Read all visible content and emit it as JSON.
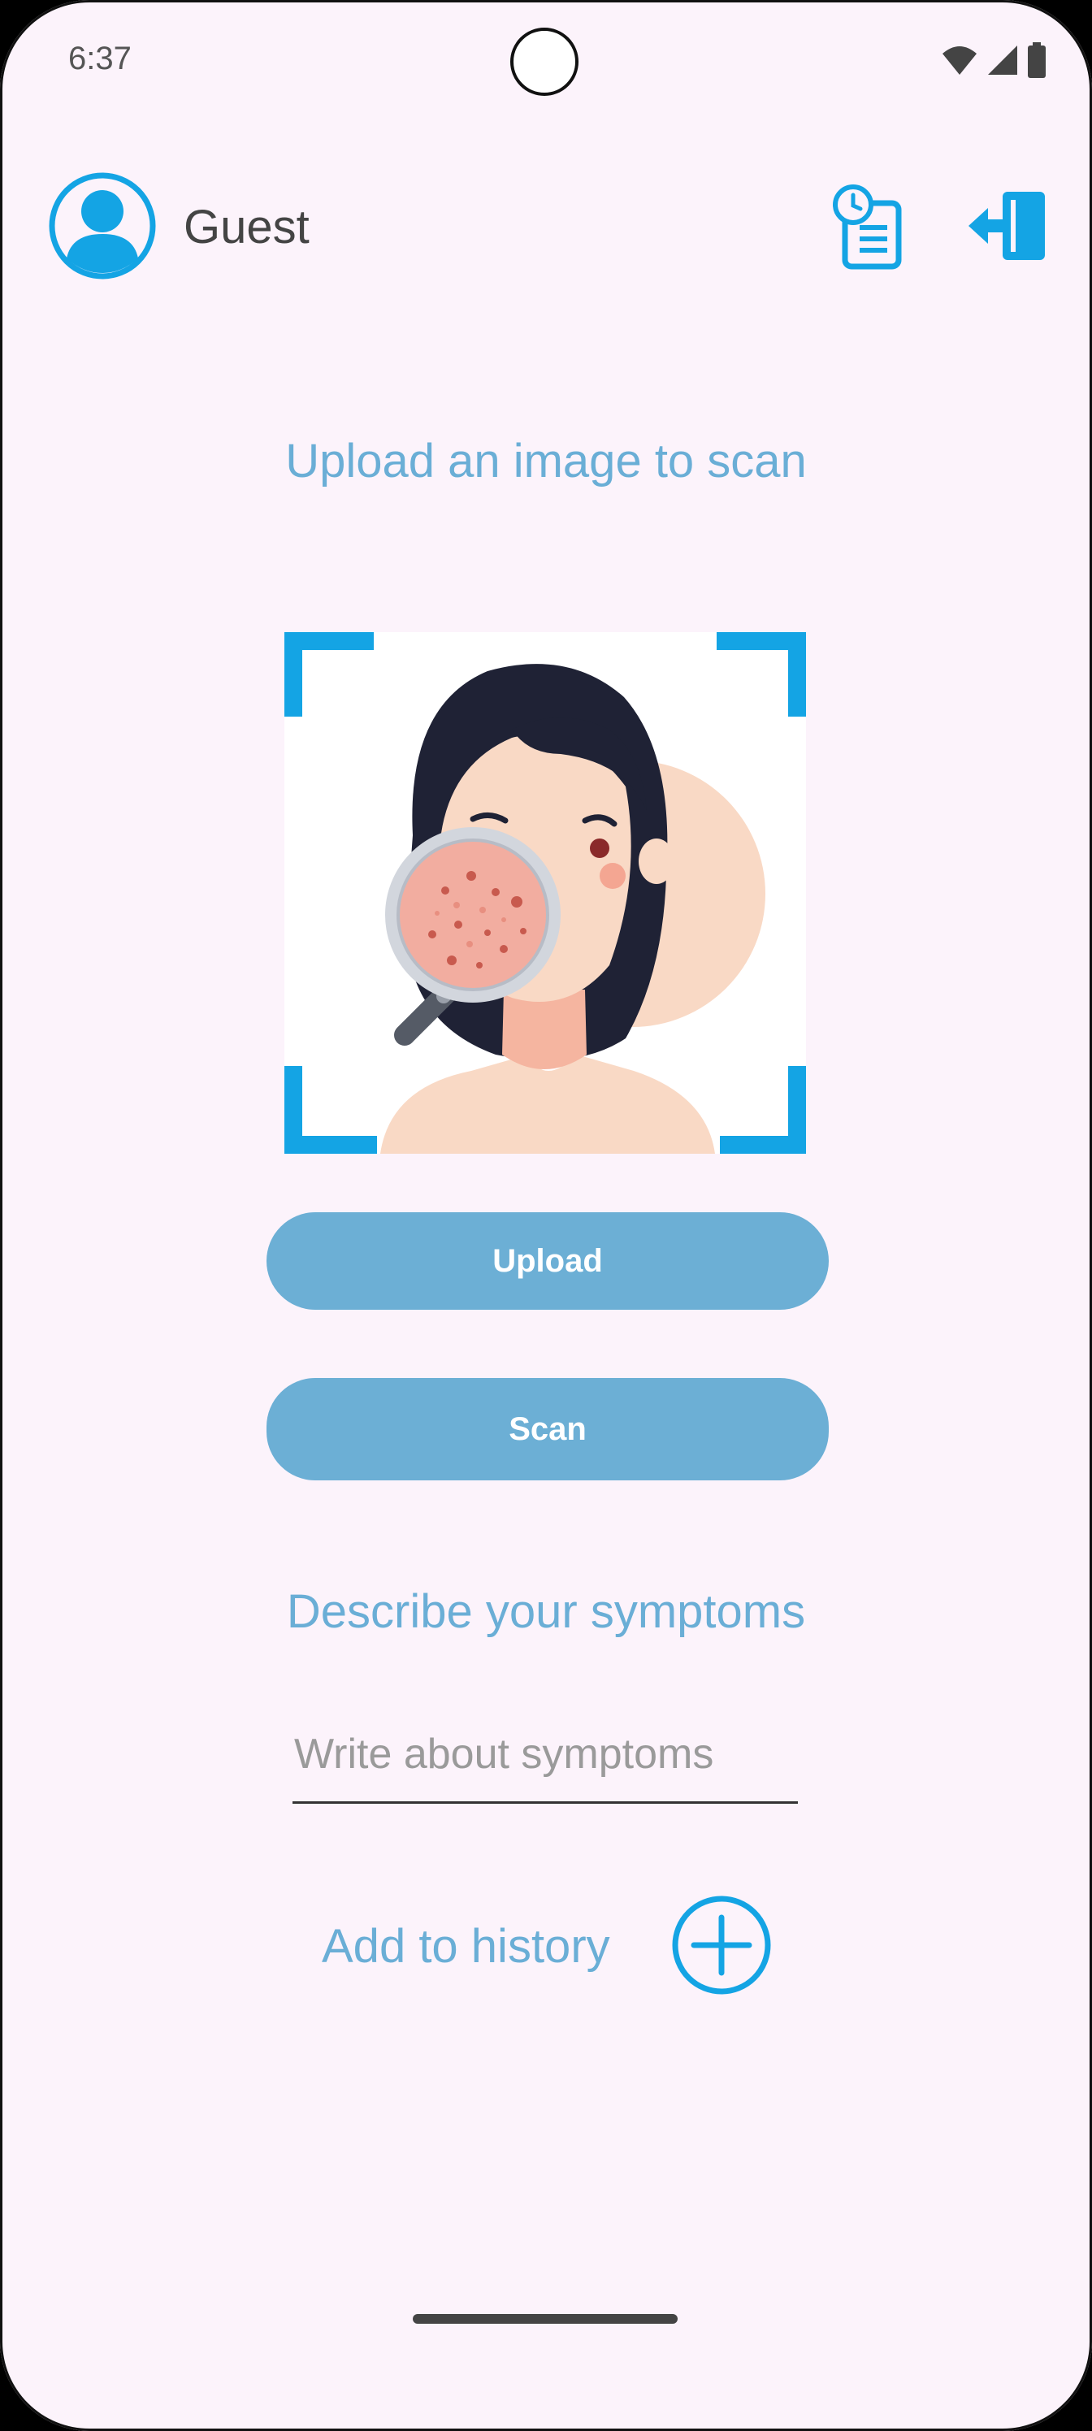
{
  "status_bar": {
    "time": "6:37",
    "icons": [
      "wifi-icon",
      "signal-icon",
      "battery-icon"
    ]
  },
  "header": {
    "username": "Guest",
    "avatar_icon": "user-avatar-icon",
    "history_icon": "history-clipboard-icon",
    "logout_icon": "logout-icon"
  },
  "main": {
    "upload_heading": "Upload an image to scan",
    "upload_button": "Upload",
    "scan_button": "Scan",
    "symptoms_heading": "Describe your symptoms",
    "symptoms_input": {
      "value": "",
      "placeholder": "Write about symptoms"
    },
    "add_history_label": "Add to history",
    "add_history_icon": "plus-circle-icon"
  },
  "colors": {
    "accent": "#6aaed6",
    "button": "#6cafd5",
    "icon_blue": "#14a4e4",
    "background": "#fcf3fb"
  }
}
